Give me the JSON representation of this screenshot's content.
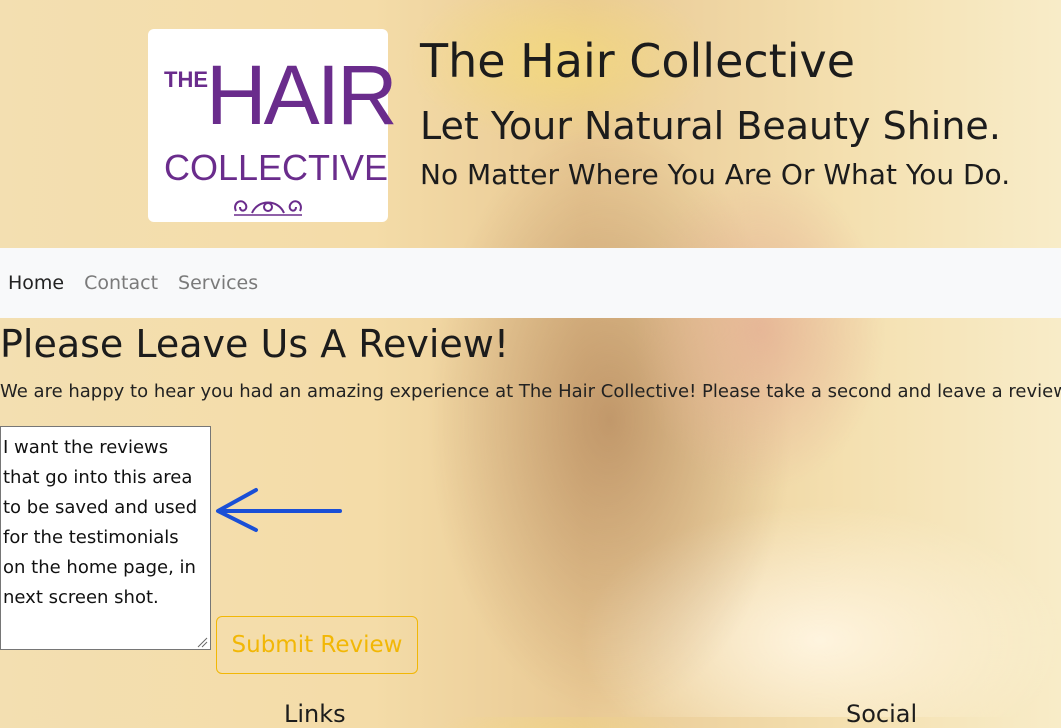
{
  "header": {
    "logo": {
      "line1": "THE",
      "line2": "HAIR",
      "line3": "COLLECTIVE"
    },
    "title": "The Hair Collective",
    "subtitle1": "Let Your Natural Beauty Shine.",
    "subtitle2": "No Matter Where You Are Or What You Do."
  },
  "nav": {
    "items": [
      {
        "label": "Home",
        "active": true
      },
      {
        "label": "Contact",
        "active": false
      },
      {
        "label": "Services",
        "active": false
      }
    ]
  },
  "review": {
    "title": "Please Leave Us A Review!",
    "text": "We are happy to hear you had an amazing experience at The Hair Collective! Please take a second and leave a review:",
    "textarea_value": "I want the reviews that go into this area to be saved and used for the testimonials on the home page, in next screen shot.",
    "submit_label": "Submit Review"
  },
  "footer": {
    "links_heading": "Links",
    "social_heading": "Social"
  },
  "colors": {
    "logo_purple": "#6a2c8c",
    "button_yellow": "#f2b705",
    "arrow_blue": "#1a4fd6",
    "navbar_bg": "#f8f9fa"
  }
}
